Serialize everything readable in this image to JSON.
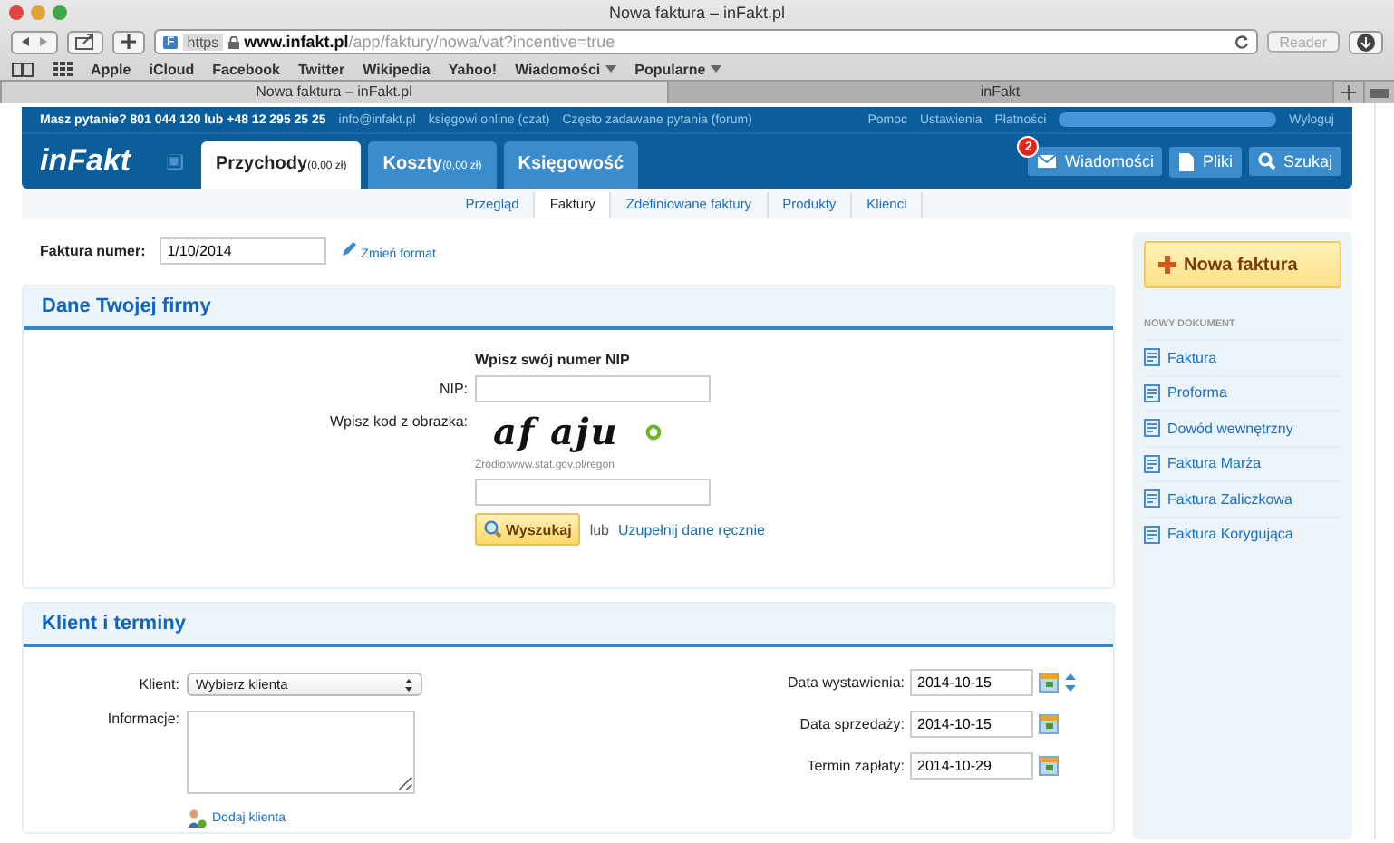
{
  "window": {
    "title": "Nowa faktura – inFakt.pl"
  },
  "toolbar": {
    "protocol": "https",
    "url_host": "www.infakt.pl",
    "url_path": "/app/faktury/nowa/vat?incentive=true",
    "favicon": "F",
    "reader": "Reader"
  },
  "bookmarks": [
    "Apple",
    "iCloud",
    "Facebook",
    "Twitter",
    "Wikipedia",
    "Yahoo!",
    {
      "label": "Wiadomości",
      "menu": true
    },
    {
      "label": "Popularne",
      "menu": true
    }
  ],
  "browser_tabs": [
    {
      "label": "Nowa faktura – inFakt.pl",
      "selected": true
    },
    {
      "label": "inFakt",
      "selected": false
    }
  ],
  "topbar": {
    "question": "Masz pytanie? 801 044 120 lub +48 12 295 25 25",
    "links": [
      "info@infakt.pl",
      "księgowi online (czat)",
      "Często zadawane pytania (forum)"
    ],
    "right_links": [
      "Pomoc",
      "Ustawienia",
      "Płatności"
    ],
    "logout": "Wyloguj"
  },
  "header": {
    "logo": "inFakt",
    "tabs": [
      {
        "label": "Przychody",
        "amount": "(0,00 zł)",
        "selected": true
      },
      {
        "label": "Koszty",
        "amount": "(0,00 zł)",
        "selected": false
      },
      {
        "label": "Księgowość",
        "selected": false
      }
    ],
    "actions": [
      {
        "label": "Wiadomości",
        "badge": "2"
      },
      {
        "label": "Pliki"
      },
      {
        "label": "Szukaj"
      }
    ]
  },
  "subnav": [
    {
      "label": "Przegląd",
      "selected": false
    },
    {
      "label": "Faktury",
      "selected": true
    },
    {
      "label": "Zdefiniowane faktury",
      "selected": false
    },
    {
      "label": "Produkty",
      "selected": false
    },
    {
      "label": "Klienci",
      "selected": false
    }
  ],
  "invoice_number": {
    "label": "Faktura numer:",
    "value": "1/10/2014",
    "link": "Zmień format"
  },
  "company_section": {
    "title": "Dane Twojej firmy",
    "heading": "Wpisz swój numer NIP",
    "nip_label": "NIP:",
    "captcha_label": "Wpisz kod z obrazka:",
    "captcha": "af aju",
    "source": "Źródło:www.stat.gov.pl/regon",
    "search_button": "Wyszukaj",
    "or": "lub",
    "manual_link": "Uzupełnij dane ręcznie"
  },
  "client_section": {
    "title": "Klient i terminy",
    "client_label": "Klient:",
    "client_value": "Wybierz klienta",
    "info_label": "Informacje:",
    "add_client": "Dodaj klienta",
    "dates": [
      {
        "label": "Data wystawienia:",
        "value": "2014-10-15",
        "stepper": true
      },
      {
        "label": "Data sprzedaży:",
        "value": "2014-10-15",
        "stepper": false
      },
      {
        "label": "Termin zapłaty:",
        "value": "2014-10-29",
        "stepper": false
      }
    ]
  },
  "sidebar": {
    "new_button": "Nowa faktura",
    "heading": "NOWY DOKUMENT",
    "items": [
      "Faktura",
      "Proforma",
      "Dowód wewnętrzny",
      "Faktura Marża",
      "Faktura Zaliczkowa",
      "Faktura Korygująca"
    ]
  }
}
